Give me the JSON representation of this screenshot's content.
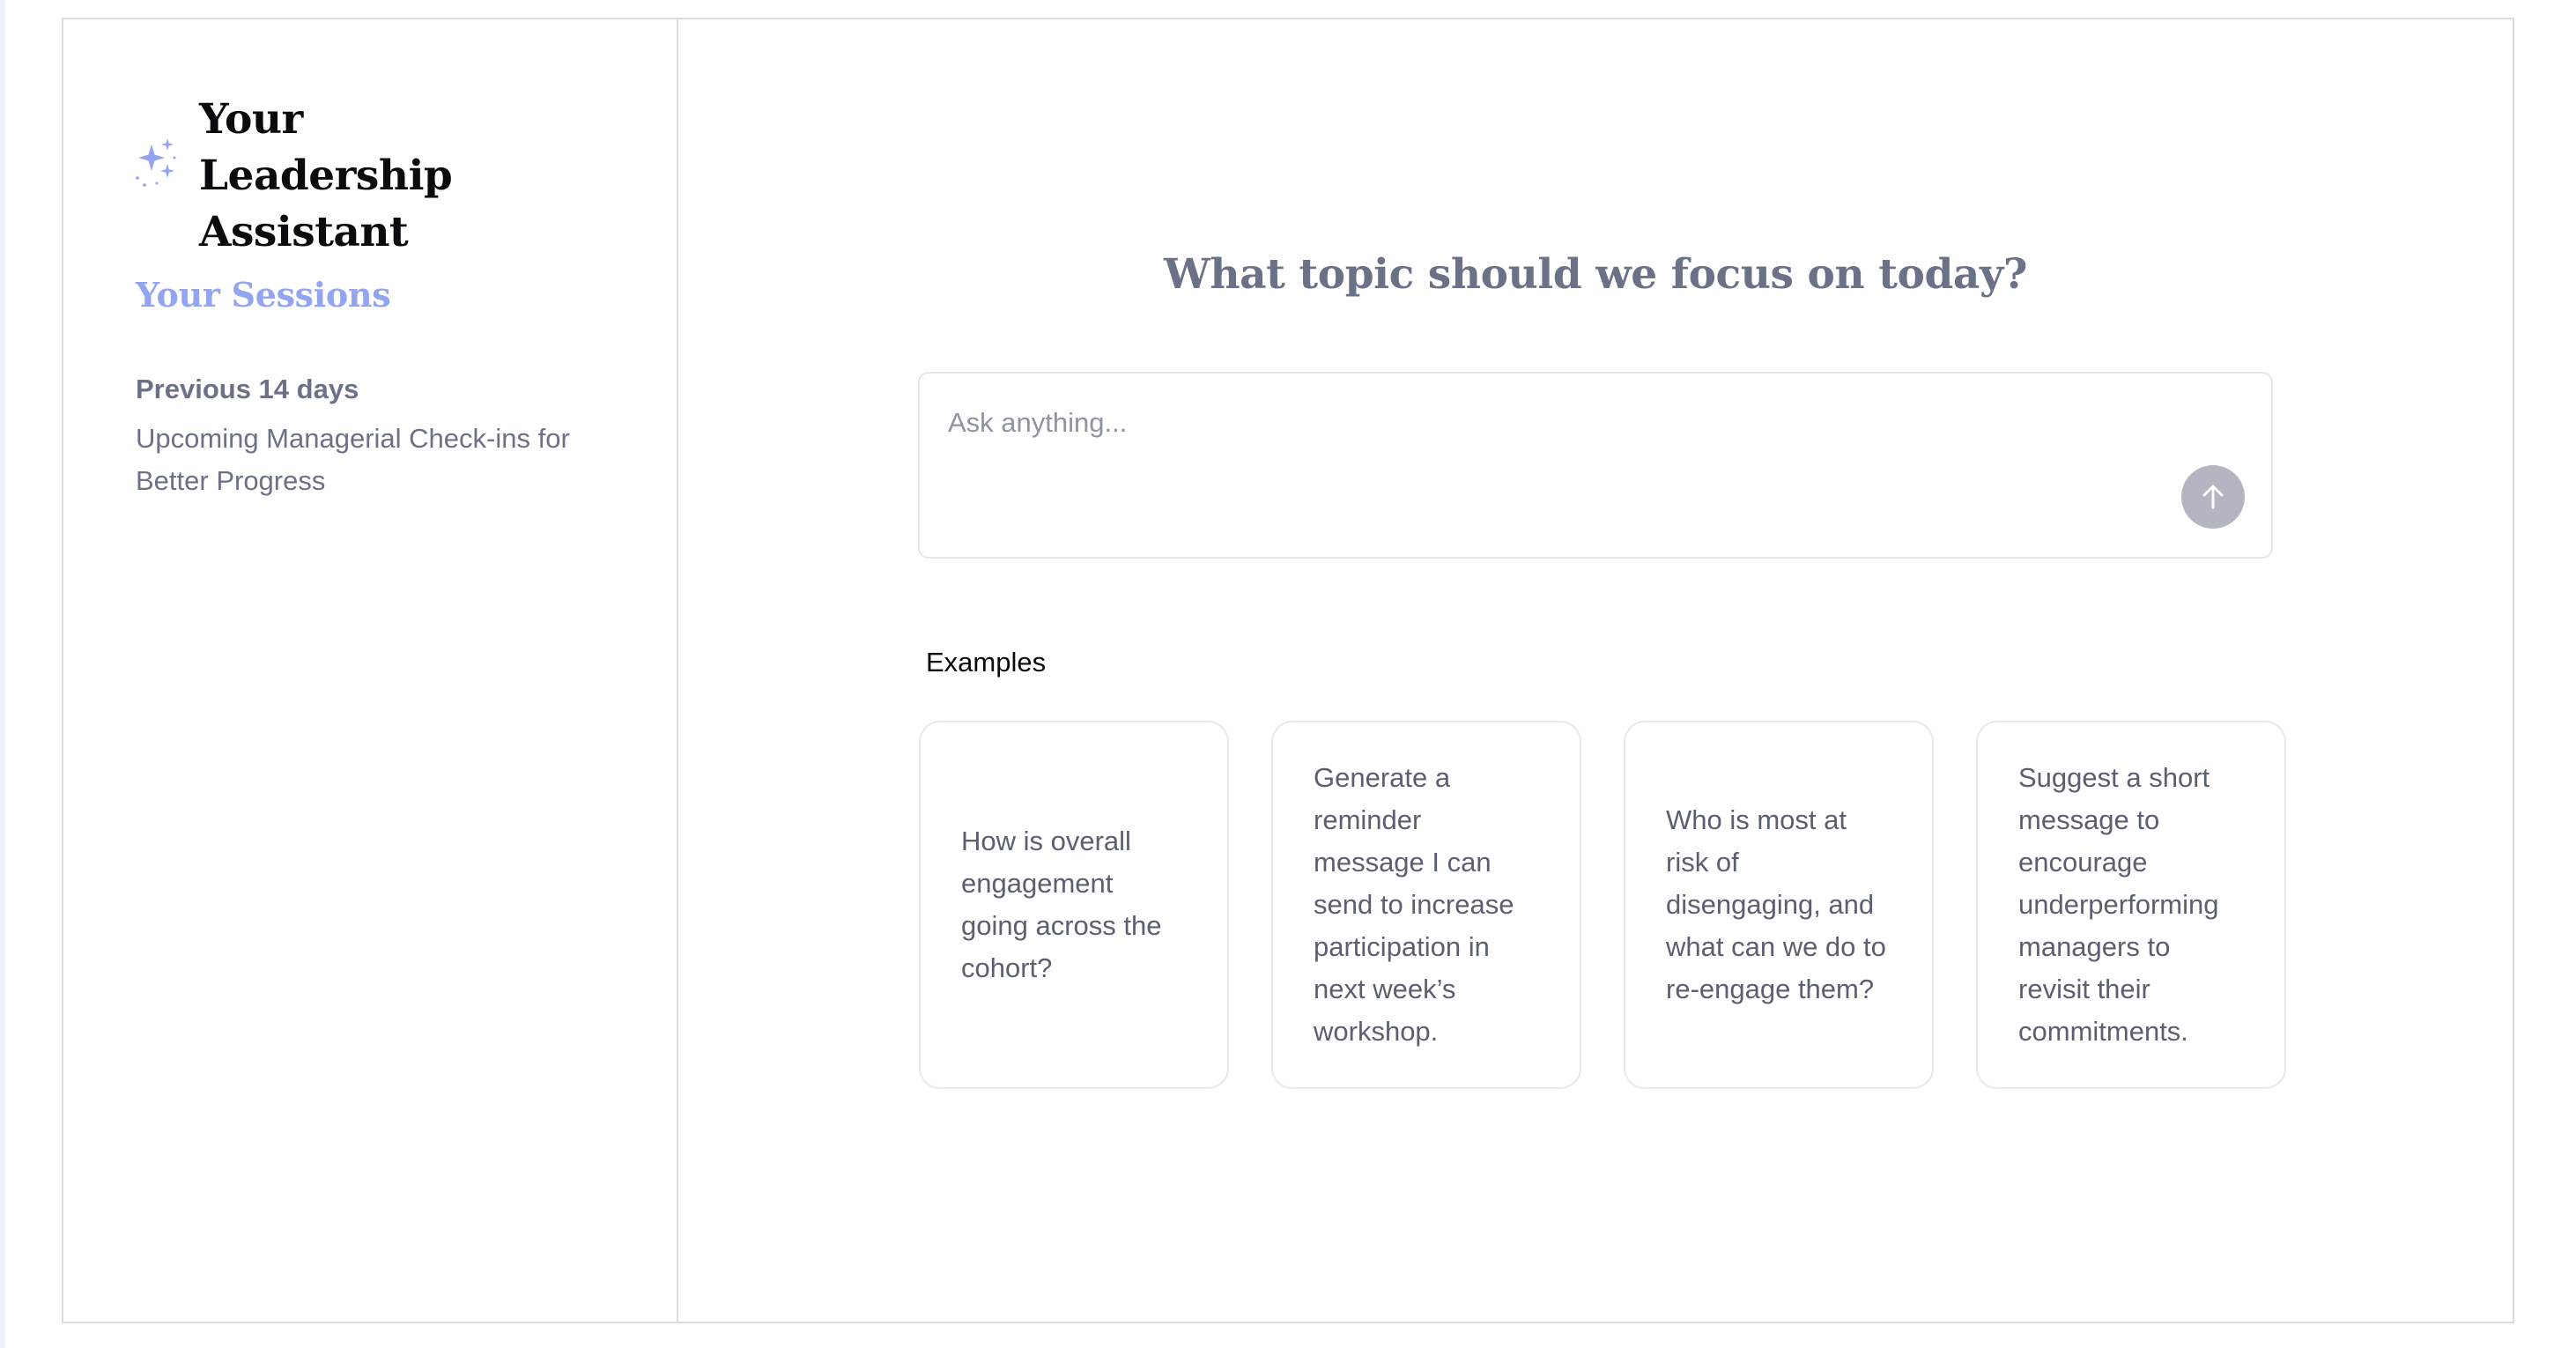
{
  "sidebar": {
    "brand_title": "Your Leadership Assistant",
    "brand_icon": "sparkles-icon",
    "sessions_title": "Your Sessions",
    "groups": [
      {
        "label": "Previous 14 days",
        "items": [
          {
            "title": "Upcoming Managerial Check-ins for Better Progress"
          }
        ]
      }
    ]
  },
  "main": {
    "heading": "What topic should we focus on today?",
    "input": {
      "placeholder": "Ask anything...",
      "value": ""
    },
    "send_icon": "arrow-up-icon",
    "examples_label": "Examples",
    "examples": [
      "How is overall engagement going across the cohort?",
      "Generate a reminder message I can send to increase participation in next week’s workshop.",
      "Who is most at risk of disengaging, and what can we do to re-engage them?",
      "Suggest a short message to encourage underperforming managers to revisit their commitments."
    ]
  },
  "colors": {
    "accent": "#93a4f1",
    "muted_text": "#6b7287",
    "send_button": "#b3b5c0",
    "border": "#d9dbe1"
  }
}
